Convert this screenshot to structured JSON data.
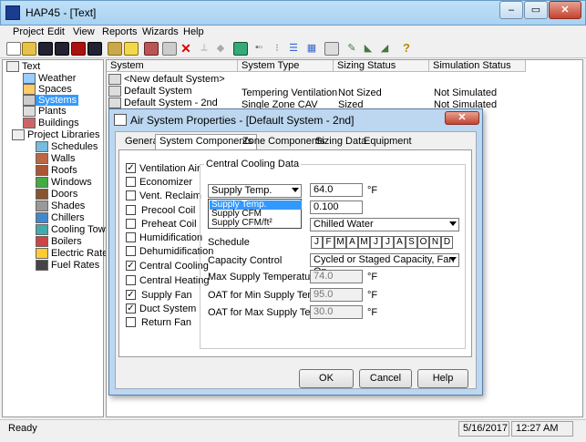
{
  "window": {
    "title": "HAP45 - [Text]",
    "minimize": "–",
    "restore": "▭",
    "close": "✕"
  },
  "menu": [
    "Project",
    "Edit",
    "View",
    "Reports",
    "Wizards",
    "Help"
  ],
  "tree": {
    "root": "Text",
    "items": [
      "Weather",
      "Spaces",
      "Systems",
      "Plants",
      "Buildings"
    ],
    "libraries_label": "Project Libraries",
    "libraries": [
      "Schedules",
      "Walls",
      "Roofs",
      "Windows",
      "Doors",
      "Shades",
      "Chillers",
      "Cooling Towers",
      "Boilers",
      "Electric Rates",
      "Fuel Rates"
    ]
  },
  "list": {
    "columns": [
      "System",
      "System Type",
      "Sizing Status",
      "Simulation Status"
    ],
    "rows": [
      [
        "<New default System>",
        "",
        "",
        ""
      ],
      [
        "Default System",
        "Tempering Ventilation",
        "Not Sized",
        "Not Simulated"
      ],
      [
        "Default System - 2nd",
        "Single Zone CAV",
        "Sized",
        "Not Simulated"
      ]
    ]
  },
  "status": {
    "left": "Ready",
    "date": "5/16/2017",
    "time": "12:27 AM"
  },
  "dialog": {
    "title": "Air System Properties - [Default System - 2nd]",
    "close": "✕",
    "tabs": [
      "General",
      "System Components",
      "Zone Components",
      "Sizing Data",
      "Equipment"
    ],
    "components": [
      {
        "label": "Ventilation Air",
        "checked": true
      },
      {
        "label": "Economizer",
        "checked": false
      },
      {
        "label": "Vent. Reclaim",
        "checked": false
      },
      {
        "label": "Precool Coil",
        "checked": false
      },
      {
        "label": "Preheat Coil",
        "checked": false
      },
      {
        "label": "Humidification",
        "checked": false
      },
      {
        "label": "Dehumidification",
        "checked": false
      },
      {
        "label": "Central Cooling",
        "checked": true
      },
      {
        "label": "Central Heating",
        "checked": false
      },
      {
        "label": "Supply Fan",
        "checked": true
      },
      {
        "label": "Duct System",
        "checked": true
      },
      {
        "label": "Return Fan",
        "checked": false
      }
    ],
    "group_title": "Central Cooling Data",
    "supply_select": "Supply Temp.",
    "dropdown_options": [
      "Supply Temp.",
      "Supply CFM",
      "Supply CFM/ft²"
    ],
    "supply_temp_value": "64.0",
    "supply_temp_unit": "°F",
    "second_value": "0.100",
    "coil_source": "Chilled Water",
    "schedule_label": "Schedule",
    "months": [
      "J",
      "F",
      "M",
      "A",
      "M",
      "J",
      "J",
      "A",
      "S",
      "O",
      "N",
      "D"
    ],
    "capacity_label": "Capacity Control",
    "capacity_value": "Cycled or Staged Capacity, Fan On",
    "max_supply_label": "Max Supply Temperature",
    "max_supply_value": "74.0",
    "oat_min_label": "OAT for Min Supply Temp",
    "oat_min_value": "95.0",
    "oat_max_label": "OAT for Max Supply Temp",
    "oat_max_value": "30.0",
    "unit_f": "°F",
    "ok": "OK",
    "cancel": "Cancel",
    "help": "Help"
  },
  "colors": {
    "title_bar": "#a9d2f1",
    "dialog_frame": "#bcd7ef",
    "close_red": "#c3432f",
    "selection": "#3399ff"
  }
}
